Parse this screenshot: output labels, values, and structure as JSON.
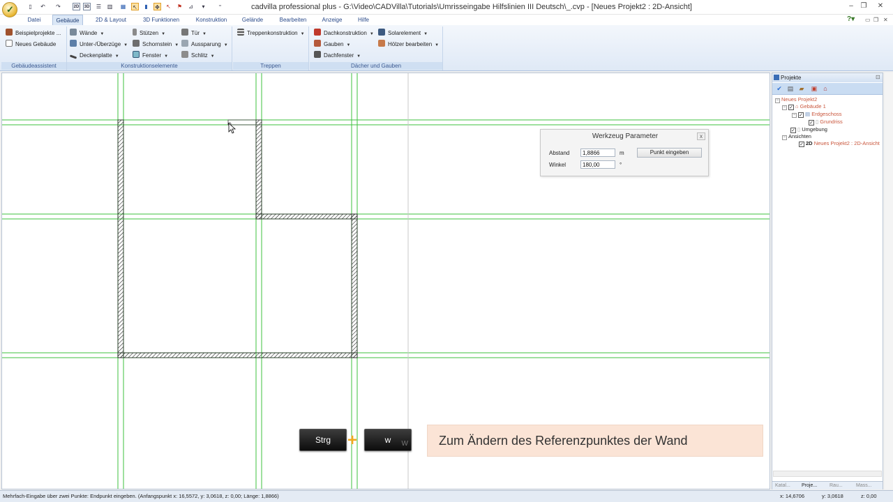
{
  "window": {
    "title": "cadvilla professional plus - G:\\Video\\CADVilla\\Tutorials\\Umrisseingabe Hilfslinien III Deutsch\\_.cvp - [Neues Projekt2 : 2D-Ansicht]",
    "quick_access": [
      "2D",
      "3D"
    ]
  },
  "tabs": [
    "Datei",
    "Gebäude",
    "2D & Layout",
    "3D Funktionen",
    "Konstruktion",
    "Gelände",
    "Bearbeiten",
    "Anzeige",
    "Hilfe"
  ],
  "ribbon": {
    "groups": {
      "gebaeudeassistent": "Gebäudeassistent",
      "konstruktionselemente": "Konstruktionselemente",
      "treppen": "Treppen",
      "daecher": "Dächer und Gauben"
    },
    "beispielprojekte": "Beispielprojekte ...",
    "neues_gebaeude": "Neues Gebäude",
    "waende": "Wände",
    "unterzuege": "Unter-/Überzüge",
    "deckenplatte": "Deckenplatte",
    "stuetzen": "Stützen",
    "schornstein": "Schornstein",
    "fenster": "Fenster",
    "tuer": "Tür",
    "aussparung": "Aussparung",
    "schlitz": "Schlitz",
    "treppenkonstruktion": "Treppenkonstruktion",
    "dachkonstruktion": "Dachkonstruktion",
    "gauben": "Gauben",
    "dachfenster": "Dachfenster",
    "solarelement": "Solarelement",
    "hoelzer": "Hölzer bearbeiten"
  },
  "params": {
    "title": "Werkzeug Parameter",
    "close": "x",
    "abstand_label": "Abstand",
    "abstand_value": "1,8866",
    "abstand_unit": "m",
    "winkel_label": "Winkel",
    "winkel_value": "180,00",
    "winkel_unit": "°",
    "button": "Punkt eingeben"
  },
  "overlay": {
    "key1": "Strg",
    "plus": "+",
    "key2": "w",
    "key2_small": "W",
    "hint": "Zum Ändern des Referenzpunktes der Wand"
  },
  "projects": {
    "title": "Projekte",
    "tree": {
      "project": "Neues Projekt2",
      "gebaeude": "Gebäude 1",
      "erdgeschoss": "Erdgeschoss",
      "grundriss": "Grundriss",
      "umgebung": "Umgebung",
      "ansichten": "Ansichten",
      "view_tag": "2D",
      "view": "Neues Projekt2 : 2D-Ansicht"
    },
    "tabs": [
      "Katal...",
      "Proje...",
      "Rau...",
      "Mass..."
    ]
  },
  "status": {
    "message": "Mehrfach-Eingabe über zwei Punkte: Endpunkt eingeben. (Anfangspunkt x: 16,5572, y: 3,0618, z: 0,00;  Länge: 1,8866)",
    "x": "x: 14,6706",
    "y": "y: 3,0618",
    "z": "z: 0,00"
  }
}
